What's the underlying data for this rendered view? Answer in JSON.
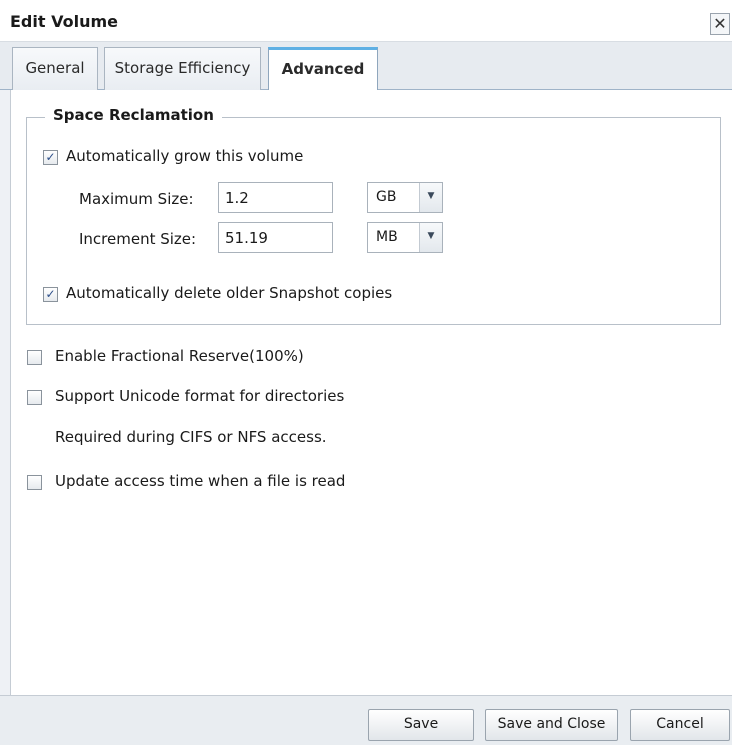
{
  "window": {
    "title": "Edit Volume",
    "close_glyph": "✕"
  },
  "tabs": [
    {
      "label": "General",
      "active": false
    },
    {
      "label": "Storage Efficiency",
      "active": false
    },
    {
      "label": "Advanced",
      "active": true
    }
  ],
  "space_reclamation": {
    "legend": "Space Reclamation",
    "autogrow": {
      "label": "Automatically grow this volume",
      "checked": true
    },
    "max_size": {
      "label": "Maximum Size:",
      "value": "1.2",
      "unit": "GB"
    },
    "increment_size": {
      "label": "Increment Size:",
      "value": "51.19",
      "unit": "MB"
    },
    "autodelete": {
      "label": "Automatically delete older Snapshot copies",
      "checked": true
    }
  },
  "options": {
    "fractional_reserve": {
      "label": "Enable Fractional Reserve(100%)",
      "checked": false
    },
    "unicode": {
      "label": "Support Unicode format for directories",
      "checked": false
    },
    "unicode_note": "Required during CIFS or NFS access.",
    "access_time": {
      "label": "Update access time when a file is read",
      "checked": false
    }
  },
  "footer": {
    "save_label": "Save",
    "save_close_label": "Save and Close",
    "cancel_label": "Cancel"
  },
  "icons": {
    "check": "✓",
    "dropdown": "▼"
  },
  "colors": {
    "active_tab_accent": "#5fb0e4",
    "check_mark": "#2d4f8a"
  }
}
